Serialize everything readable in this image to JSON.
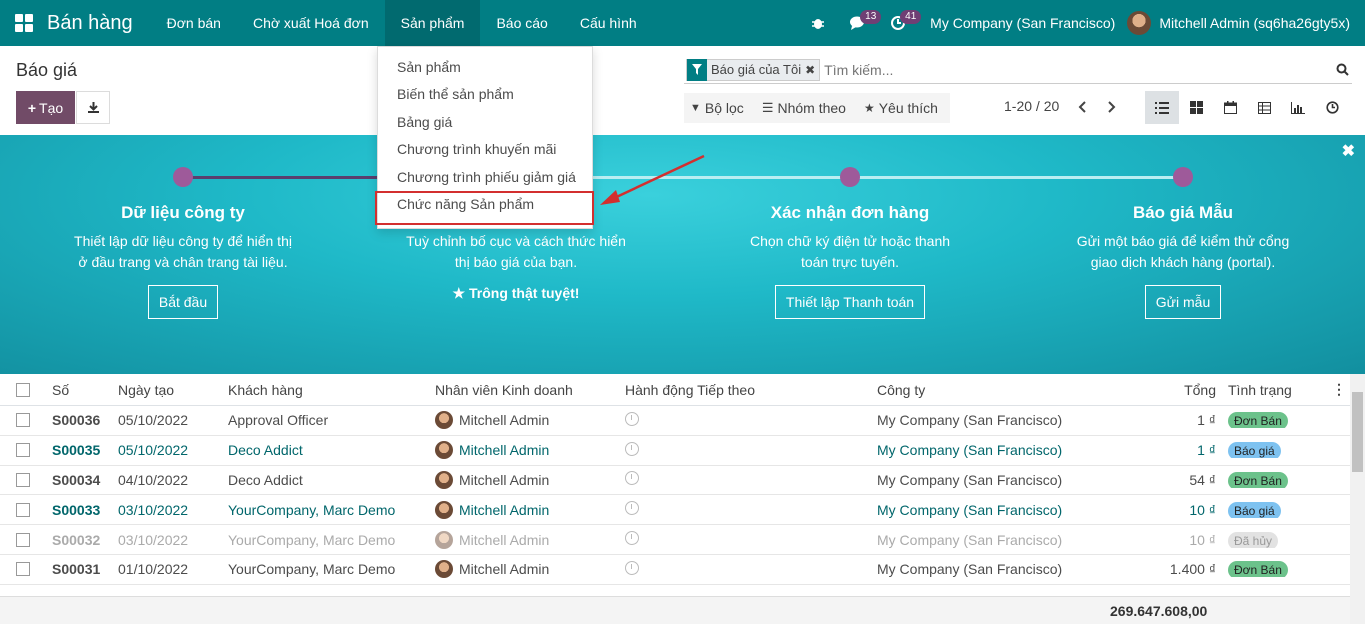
{
  "topbar": {
    "app_name": "Bán hàng",
    "menu": [
      "Đơn bán",
      "Chờ xuất Hoá đơn",
      "Sản phẩm",
      "Báo cáo",
      "Cấu hình"
    ],
    "messages_count": "13",
    "activities_count": "41",
    "company": "My Company (San Francisco)",
    "user": "Mitchell Admin (sq6ha26gty5x)"
  },
  "control_panel": {
    "title": "Báo giá",
    "create_label": "Tạo",
    "facet": "Báo giá của Tôi",
    "search_placeholder": "Tìm kiếm...",
    "filters_label": "Bộ lọc",
    "group_by_label": "Nhóm theo",
    "favorites_label": "Yêu thích",
    "pager": "1-20 / 20"
  },
  "dropdown": {
    "items": [
      "Sản phẩm",
      "Biến thể sản phẩm",
      "Bảng giá",
      "Chương trình khuyến mãi",
      "Chương trình phiếu giảm giá",
      "Chức năng Sản phẩm"
    ]
  },
  "banner": {
    "steps": [
      {
        "title": "Dữ liệu công ty",
        "desc": "Thiết lập dữ liệu công ty để hiển thị ở đầu trang và chân trang tài liệu.",
        "button": "Bắt đầu"
      },
      {
        "title": "",
        "desc": "Tuỳ chỉnh bố cục và cách thức hiển thị báo giá của bạn.",
        "done": "Trông thật tuyệt!"
      },
      {
        "title": "Xác nhận đơn hàng",
        "desc": "Chọn chữ ký điện tử hoặc thanh toán trực tuyến.",
        "button": "Thiết lập Thanh toán"
      },
      {
        "title": "Báo giá Mẫu",
        "desc": "Gửi một báo giá để kiểm thử cổng giao dịch khách hàng (portal).",
        "button": "Gửi mẫu"
      }
    ]
  },
  "table": {
    "headers": [
      "Số",
      "Ngày tạo",
      "Khách hàng",
      "Nhân viên Kinh doanh",
      "Hành động Tiếp theo",
      "Công ty",
      "Tổng",
      "Tình trạng"
    ],
    "rows": [
      {
        "num": "S00036",
        "date": "05/10/2022",
        "customer": "Approval Officer",
        "salesperson": "Mitchell Admin",
        "company": "My Company (San Francisco)",
        "total": "1 ₫",
        "status": "Đơn Bán"
      },
      {
        "num": "S00035",
        "date": "05/10/2022",
        "customer": "Deco Addict",
        "salesperson": "Mitchell Admin",
        "company": "My Company (San Francisco)",
        "total": "1 ₫",
        "status": "Báo giá"
      },
      {
        "num": "S00034",
        "date": "04/10/2022",
        "customer": "Deco Addict",
        "salesperson": "Mitchell Admin",
        "company": "My Company (San Francisco)",
        "total": "54 ₫",
        "status": "Đơn Bán"
      },
      {
        "num": "S00033",
        "date": "03/10/2022",
        "customer": "YourCompany, Marc Demo",
        "salesperson": "Mitchell Admin",
        "company": "My Company (San Francisco)",
        "total": "10 ₫",
        "status": "Báo giá"
      },
      {
        "num": "S00032",
        "date": "03/10/2022",
        "customer": "YourCompany, Marc Demo",
        "salesperson": "Mitchell Admin",
        "company": "My Company (San Francisco)",
        "total": "10 ₫",
        "status": "Đã hủy"
      },
      {
        "num": "S00031",
        "date": "01/10/2022",
        "customer": "YourCompany, Marc Demo",
        "salesperson": "Mitchell Admin",
        "company": "My Company (San Francisco)",
        "total": "1.400 ₫",
        "status": "Đơn Bán"
      }
    ],
    "grand_total": "269.647.608,00"
  }
}
